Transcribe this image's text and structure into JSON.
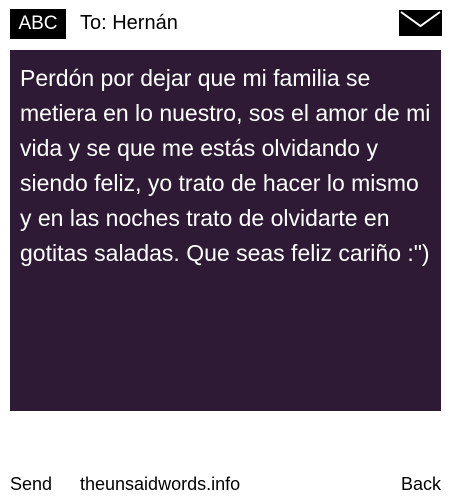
{
  "header": {
    "abc_label": "ABC",
    "to_label": "To: Hernán",
    "envelope_icon": "envelope-icon"
  },
  "message": {
    "text": "Perdón por dejar que mi familia se metiera en lo nuestro, sos el amor de mi vida y se que me estás olvidando y siendo feliz, yo trato de hacer lo mismo y en las noches trato de olvidarte en gotitas saladas. Que seas feliz cariño :\")",
    "background_color": "#2e1a35",
    "text_color": "#ffffff"
  },
  "footer": {
    "send_label": "Send",
    "site_label": "theunsaidwords.info",
    "back_label": "Back"
  }
}
